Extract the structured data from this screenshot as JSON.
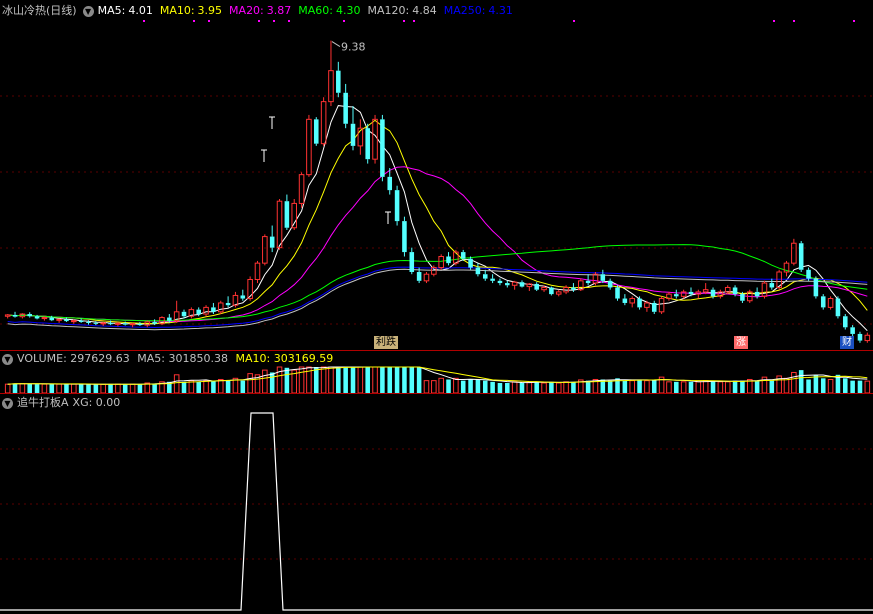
{
  "main": {
    "title": "冰山冷热(日线)",
    "ma": [
      {
        "label": "MA5:",
        "value": "4.01",
        "color": "#ffffff"
      },
      {
        "label": "MA10:",
        "value": "3.95",
        "color": "#ffff00"
      },
      {
        "label": "MA20:",
        "value": "3.87",
        "color": "#ff00ff"
      },
      {
        "label": "MA60:",
        "value": "4.30",
        "color": "#00ff00"
      },
      {
        "label": "MA120:",
        "value": "4.84",
        "color": "#c0c0c0"
      },
      {
        "label": "MA250:",
        "value": "4.31",
        "color": "#0000ff"
      }
    ],
    "high_label": "9.38",
    "markers": {
      "drop": "利跌",
      "rise": "涨",
      "money": "财"
    },
    "chart_data": {
      "type": "candlestick",
      "price_range": [
        2.5,
        9.8
      ],
      "candles": [
        [
          3.15,
          3.2,
          3.1,
          3.18
        ],
        [
          3.18,
          3.25,
          3.12,
          3.14
        ],
        [
          3.14,
          3.22,
          3.1,
          3.2
        ],
        [
          3.2,
          3.24,
          3.12,
          3.15
        ],
        [
          3.15,
          3.18,
          3.08,
          3.1
        ],
        [
          3.1,
          3.15,
          3.05,
          3.12
        ],
        [
          3.12,
          3.16,
          3.04,
          3.06
        ],
        [
          3.06,
          3.1,
          3.0,
          3.08
        ],
        [
          3.08,
          3.12,
          3.02,
          3.04
        ],
        [
          3.04,
          3.08,
          2.98,
          3.05
        ],
        [
          3.05,
          3.1,
          3.0,
          3.02
        ],
        [
          3.02,
          3.06,
          2.96,
          3.0
        ],
        [
          3.0,
          3.04,
          2.95,
          2.98
        ],
        [
          2.98,
          3.02,
          2.93,
          3.0
        ],
        [
          3.0,
          3.05,
          2.95,
          2.97
        ],
        [
          2.97,
          3.02,
          2.92,
          2.99
        ],
        [
          2.99,
          3.03,
          2.94,
          2.96
        ],
        [
          2.96,
          3.0,
          2.9,
          2.98
        ],
        [
          2.98,
          3.02,
          2.93,
          2.95
        ],
        [
          2.95,
          3.05,
          2.9,
          3.02
        ],
        [
          3.02,
          3.08,
          2.95,
          2.98
        ],
        [
          2.98,
          3.15,
          2.95,
          3.12
        ],
        [
          3.12,
          3.2,
          3.0,
          3.05
        ],
        [
          3.05,
          3.5,
          3.0,
          3.25
        ],
        [
          3.25,
          3.3,
          3.1,
          3.15
        ],
        [
          3.15,
          3.35,
          3.1,
          3.3
        ],
        [
          3.3,
          3.35,
          3.15,
          3.2
        ],
        [
          3.2,
          3.4,
          3.15,
          3.35
        ],
        [
          3.35,
          3.45,
          3.2,
          3.25
        ],
        [
          3.25,
          3.5,
          3.2,
          3.45
        ],
        [
          3.45,
          3.6,
          3.35,
          3.4
        ],
        [
          3.4,
          3.7,
          3.35,
          3.62
        ],
        [
          3.62,
          3.75,
          3.5,
          3.55
        ],
        [
          3.55,
          4.05,
          3.5,
          3.98
        ],
        [
          3.98,
          4.4,
          3.9,
          4.35
        ],
        [
          4.35,
          5.0,
          4.3,
          4.95
        ],
        [
          4.95,
          5.2,
          4.6,
          4.7
        ],
        [
          4.7,
          5.8,
          4.65,
          5.75
        ],
        [
          5.75,
          5.9,
          5.1,
          5.15
        ],
        [
          5.15,
          5.8,
          5.1,
          5.7
        ],
        [
          5.7,
          6.4,
          5.6,
          6.35
        ],
        [
          6.35,
          7.7,
          6.3,
          7.6
        ],
        [
          7.6,
          7.65,
          7.0,
          7.05
        ],
        [
          7.05,
          8.1,
          7.0,
          8.0
        ],
        [
          8.0,
          9.38,
          7.9,
          8.7
        ],
        [
          8.7,
          8.9,
          8.1,
          8.2
        ],
        [
          8.2,
          8.4,
          7.4,
          7.5
        ],
        [
          7.5,
          7.9,
          6.9,
          7.0
        ],
        [
          7.0,
          7.6,
          6.8,
          7.4
        ],
        [
          7.4,
          7.5,
          6.6,
          6.7
        ],
        [
          6.7,
          7.7,
          6.6,
          7.6
        ],
        [
          7.6,
          7.7,
          6.2,
          6.3
        ],
        [
          6.3,
          6.5,
          5.9,
          6.0
        ],
        [
          6.0,
          6.1,
          5.2,
          5.3
        ],
        [
          5.3,
          5.4,
          4.5,
          4.6
        ],
        [
          4.6,
          4.7,
          4.1,
          4.15
        ],
        [
          4.15,
          4.25,
          3.9,
          3.95
        ],
        [
          3.95,
          4.15,
          3.9,
          4.1
        ],
        [
          4.1,
          4.3,
          4.05,
          4.25
        ],
        [
          4.25,
          4.55,
          4.2,
          4.5
        ],
        [
          4.5,
          4.6,
          4.3,
          4.35
        ],
        [
          4.35,
          4.65,
          4.3,
          4.6
        ],
        [
          4.6,
          4.65,
          4.4,
          4.45
        ],
        [
          4.45,
          4.5,
          4.2,
          4.25
        ],
        [
          4.25,
          4.35,
          4.05,
          4.1
        ],
        [
          4.1,
          4.2,
          3.95,
          4.0
        ],
        [
          4.0,
          4.1,
          3.9,
          3.95
        ],
        [
          3.95,
          4.0,
          3.85,
          3.9
        ],
        [
          3.9,
          3.95,
          3.8,
          3.85
        ],
        [
          3.85,
          3.95,
          3.75,
          3.92
        ],
        [
          3.92,
          3.96,
          3.8,
          3.82
        ],
        [
          3.82,
          3.9,
          3.72,
          3.88
        ],
        [
          3.88,
          3.92,
          3.72,
          3.75
        ],
        [
          3.75,
          3.85,
          3.7,
          3.8
        ],
        [
          3.8,
          3.82,
          3.62,
          3.65
        ],
        [
          3.65,
          3.75,
          3.6,
          3.7
        ],
        [
          3.7,
          3.85,
          3.65,
          3.8
        ],
        [
          3.8,
          3.9,
          3.7,
          3.75
        ],
        [
          3.75,
          4.0,
          3.72,
          3.95
        ],
        [
          3.95,
          4.1,
          3.85,
          3.9
        ],
        [
          3.9,
          4.15,
          3.85,
          4.1
        ],
        [
          4.1,
          4.2,
          3.9,
          3.95
        ],
        [
          3.95,
          4.0,
          3.75,
          3.8
        ],
        [
          3.8,
          3.85,
          3.5,
          3.55
        ],
        [
          3.55,
          3.65,
          3.4,
          3.45
        ],
        [
          3.45,
          3.6,
          3.35,
          3.55
        ],
        [
          3.55,
          3.6,
          3.3,
          3.35
        ],
        [
          3.35,
          3.5,
          3.25,
          3.45
        ],
        [
          3.45,
          3.5,
          3.2,
          3.25
        ],
        [
          3.25,
          3.6,
          3.2,
          3.55
        ],
        [
          3.55,
          3.7,
          3.5,
          3.65
        ],
        [
          3.65,
          3.75,
          3.55,
          3.6
        ],
        [
          3.6,
          3.75,
          3.55,
          3.7
        ],
        [
          3.7,
          3.8,
          3.6,
          3.65
        ],
        [
          3.65,
          3.75,
          3.55,
          3.7
        ],
        [
          3.7,
          3.9,
          3.65,
          3.75
        ],
        [
          3.75,
          3.8,
          3.55,
          3.6
        ],
        [
          3.6,
          3.75,
          3.55,
          3.7
        ],
        [
          3.7,
          3.85,
          3.65,
          3.8
        ],
        [
          3.8,
          3.85,
          3.6,
          3.65
        ],
        [
          3.65,
          3.7,
          3.45,
          3.5
        ],
        [
          3.5,
          3.75,
          3.45,
          3.7
        ],
        [
          3.7,
          3.8,
          3.55,
          3.6
        ],
        [
          3.6,
          3.95,
          3.55,
          3.9
        ],
        [
          3.9,
          4.0,
          3.75,
          3.8
        ],
        [
          3.8,
          4.2,
          3.75,
          4.15
        ],
        [
          4.15,
          4.4,
          4.05,
          4.35
        ],
        [
          4.35,
          4.9,
          4.3,
          4.8
        ],
        [
          4.8,
          4.85,
          4.15,
          4.2
        ],
        [
          4.2,
          4.25,
          3.95,
          4.0
        ],
        [
          4.0,
          4.05,
          3.55,
          3.6
        ],
        [
          3.6,
          3.65,
          3.3,
          3.35
        ],
        [
          3.35,
          3.6,
          3.3,
          3.55
        ],
        [
          3.55,
          3.6,
          3.1,
          3.15
        ],
        [
          3.15,
          3.2,
          2.85,
          2.9
        ],
        [
          2.9,
          2.95,
          2.7,
          2.75
        ],
        [
          2.75,
          2.8,
          2.55,
          2.6
        ],
        [
          2.6,
          2.78,
          2.55,
          2.72
        ]
      ]
    }
  },
  "volume": {
    "label": "VOLUME:",
    "value": "297629.63",
    "ma5_label": "MA5:",
    "ma5_value": "301850.38",
    "ma10_label": "MA10:",
    "ma10_value": "303169.59"
  },
  "indicator": {
    "name": "追牛打板A",
    "xg_label": "XG:",
    "xg_value": "0.00"
  }
}
